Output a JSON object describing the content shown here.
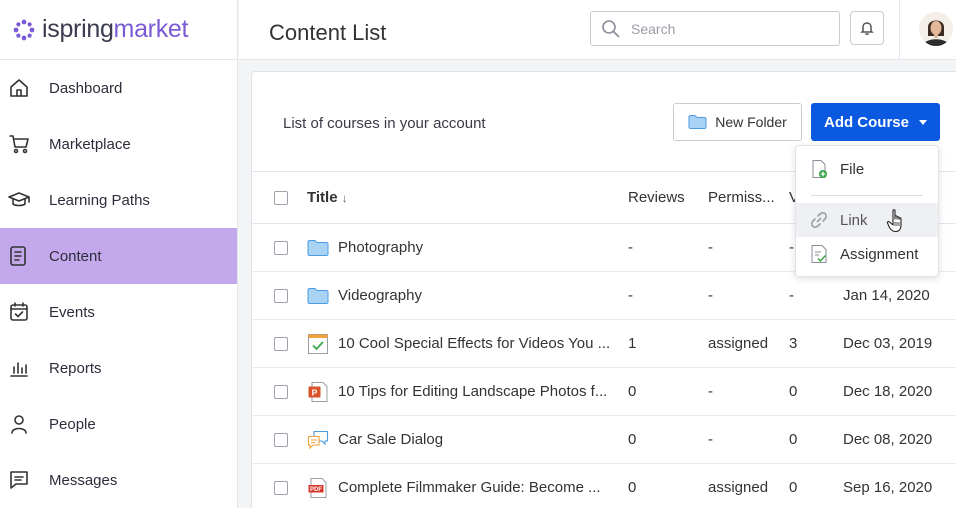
{
  "brand": {
    "part1": "ispring",
    "part2": "market"
  },
  "sidebar": {
    "items": [
      {
        "label": "Dashboard",
        "icon": "home-icon"
      },
      {
        "label": "Marketplace",
        "icon": "cart-icon"
      },
      {
        "label": "Learning Paths",
        "icon": "graduation-cap-icon"
      },
      {
        "label": "Content",
        "icon": "document-icon",
        "active": true
      },
      {
        "label": "Events",
        "icon": "calendar-check-icon"
      },
      {
        "label": "Reports",
        "icon": "bar-chart-icon"
      },
      {
        "label": "People",
        "icon": "person-icon"
      },
      {
        "label": "Messages",
        "icon": "message-icon"
      }
    ]
  },
  "header": {
    "title": "Content List",
    "search_placeholder": "Search"
  },
  "main": {
    "subtitle": "List of courses in your account",
    "new_folder_label": "New Folder",
    "add_course_label": "Add Course",
    "columns": {
      "title": "Title",
      "reviews": "Reviews",
      "permissions": "Permiss...",
      "views": "V"
    },
    "rows": [
      {
        "title": "Photography",
        "icon": "folder-icon",
        "reviews": "-",
        "permissions": "-",
        "views": "-",
        "date": ""
      },
      {
        "title": "Videography",
        "icon": "folder-icon",
        "reviews": "-",
        "permissions": "-",
        "views": "-",
        "date": "Jan 14, 2020"
      },
      {
        "title": "10 Cool Special Effects for Videos You ...",
        "icon": "quiz-icon",
        "reviews": "1",
        "permissions": "assigned",
        "views": "3",
        "date": "Dec 03, 2019"
      },
      {
        "title": "10 Tips for Editing Landscape Photos f...",
        "icon": "powerpoint-icon",
        "reviews": "0",
        "permissions": "-",
        "views": "0",
        "date": "Dec 18, 2020"
      },
      {
        "title": "Car Sale Dialog",
        "icon": "dialog-icon",
        "reviews": "0",
        "permissions": "-",
        "views": "0",
        "date": "Dec 08, 2020"
      },
      {
        "title": "Complete Filmmaker Guide: Become ...",
        "icon": "pdf-icon",
        "reviews": "0",
        "permissions": "assigned",
        "views": "0",
        "date": "Sep 16, 2020"
      }
    ]
  },
  "dropdown": {
    "items": [
      {
        "label": "File",
        "icon": "file-add-icon"
      },
      {
        "label": "Link",
        "icon": "link-icon"
      },
      {
        "label": "Assignment",
        "icon": "assignment-icon"
      }
    ]
  },
  "colors": {
    "accent": "#0b59e0",
    "active_nav": "#c3a8ec",
    "brand_purple": "#7b5ad6"
  }
}
